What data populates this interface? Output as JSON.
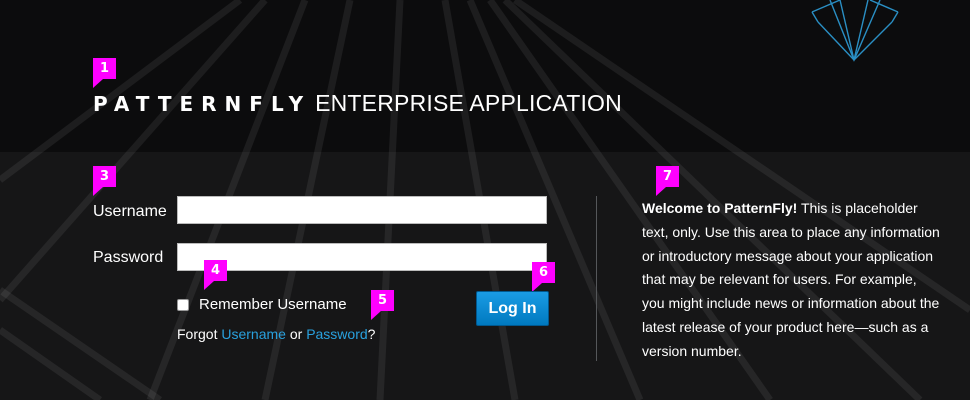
{
  "brand": {
    "name": "PATTERNFLY",
    "subtitle": "ENTERPRISE APPLICATION"
  },
  "form": {
    "username_label": "Username",
    "username_value": "",
    "password_label": "Password",
    "password_value": "",
    "remember_label": "Remember Username",
    "remember_checked": false,
    "forgot_prefix": "Forgot",
    "forgot_username": "Username",
    "forgot_or": "or",
    "forgot_password": "Password",
    "forgot_suffix": "?",
    "login_label": "Log In"
  },
  "welcome": {
    "heading": "Welcome to PatternFly!",
    "body": "This is placeholder text, only. Use this area to place any information or introductory message about your application that may be relevant for users. For example, you might include news or information about the latest release of your product here—such as a version number."
  },
  "callouts": [
    "1",
    "3",
    "4",
    "5",
    "6",
    "7"
  ],
  "colors": {
    "background": "#0c0c0d",
    "link": "#29a1de",
    "button": "#0079bf",
    "callout": "#ff00ff",
    "logo_stroke": "#2a8fc4"
  },
  "icons": {
    "logo": "patternfly-logo-icon",
    "checkbox": "checkbox-icon"
  }
}
